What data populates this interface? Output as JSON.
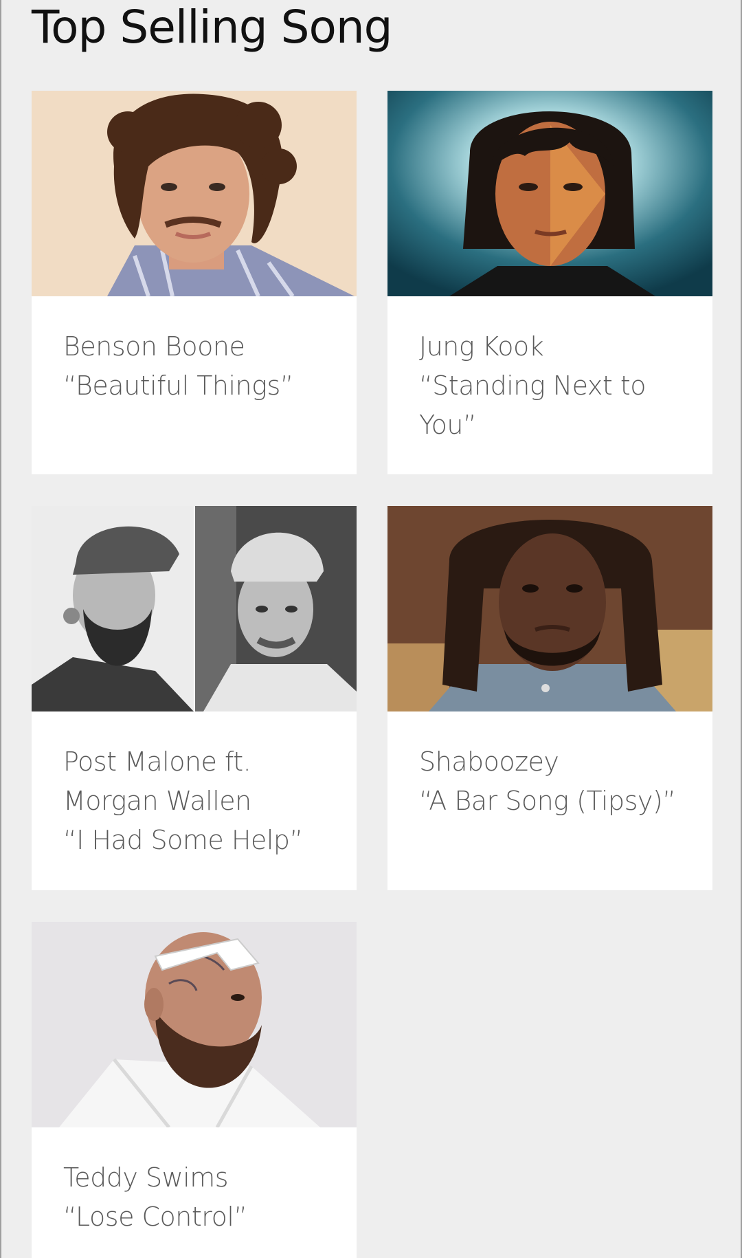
{
  "page": {
    "title": "Top Selling Song"
  },
  "songs": [
    {
      "artist": "Benson Boone",
      "song": "“Beautiful Things”",
      "photo_icon": "artist-photo-icon"
    },
    {
      "artist": "Jung Kook",
      "song": "“Standing Next to You”",
      "photo_icon": "artist-photo-icon"
    },
    {
      "artist_line1": "Post Malone ft.",
      "artist_line2": "Morgan Wallen",
      "song": "“I Had Some Help”",
      "photo_icon": "artist-photo-icon"
    },
    {
      "artist": "Shaboozey",
      "song": "“A Bar Song (Tipsy)”",
      "photo_icon": "artist-photo-icon"
    },
    {
      "artist": "Teddy Swims",
      "song": "“Lose Control”",
      "photo_icon": "artist-photo-icon"
    }
  ],
  "colors": {
    "background": "#eeeeee",
    "card": "#ffffff",
    "title_text": "#111111",
    "card_text": "#5a5a5a"
  }
}
